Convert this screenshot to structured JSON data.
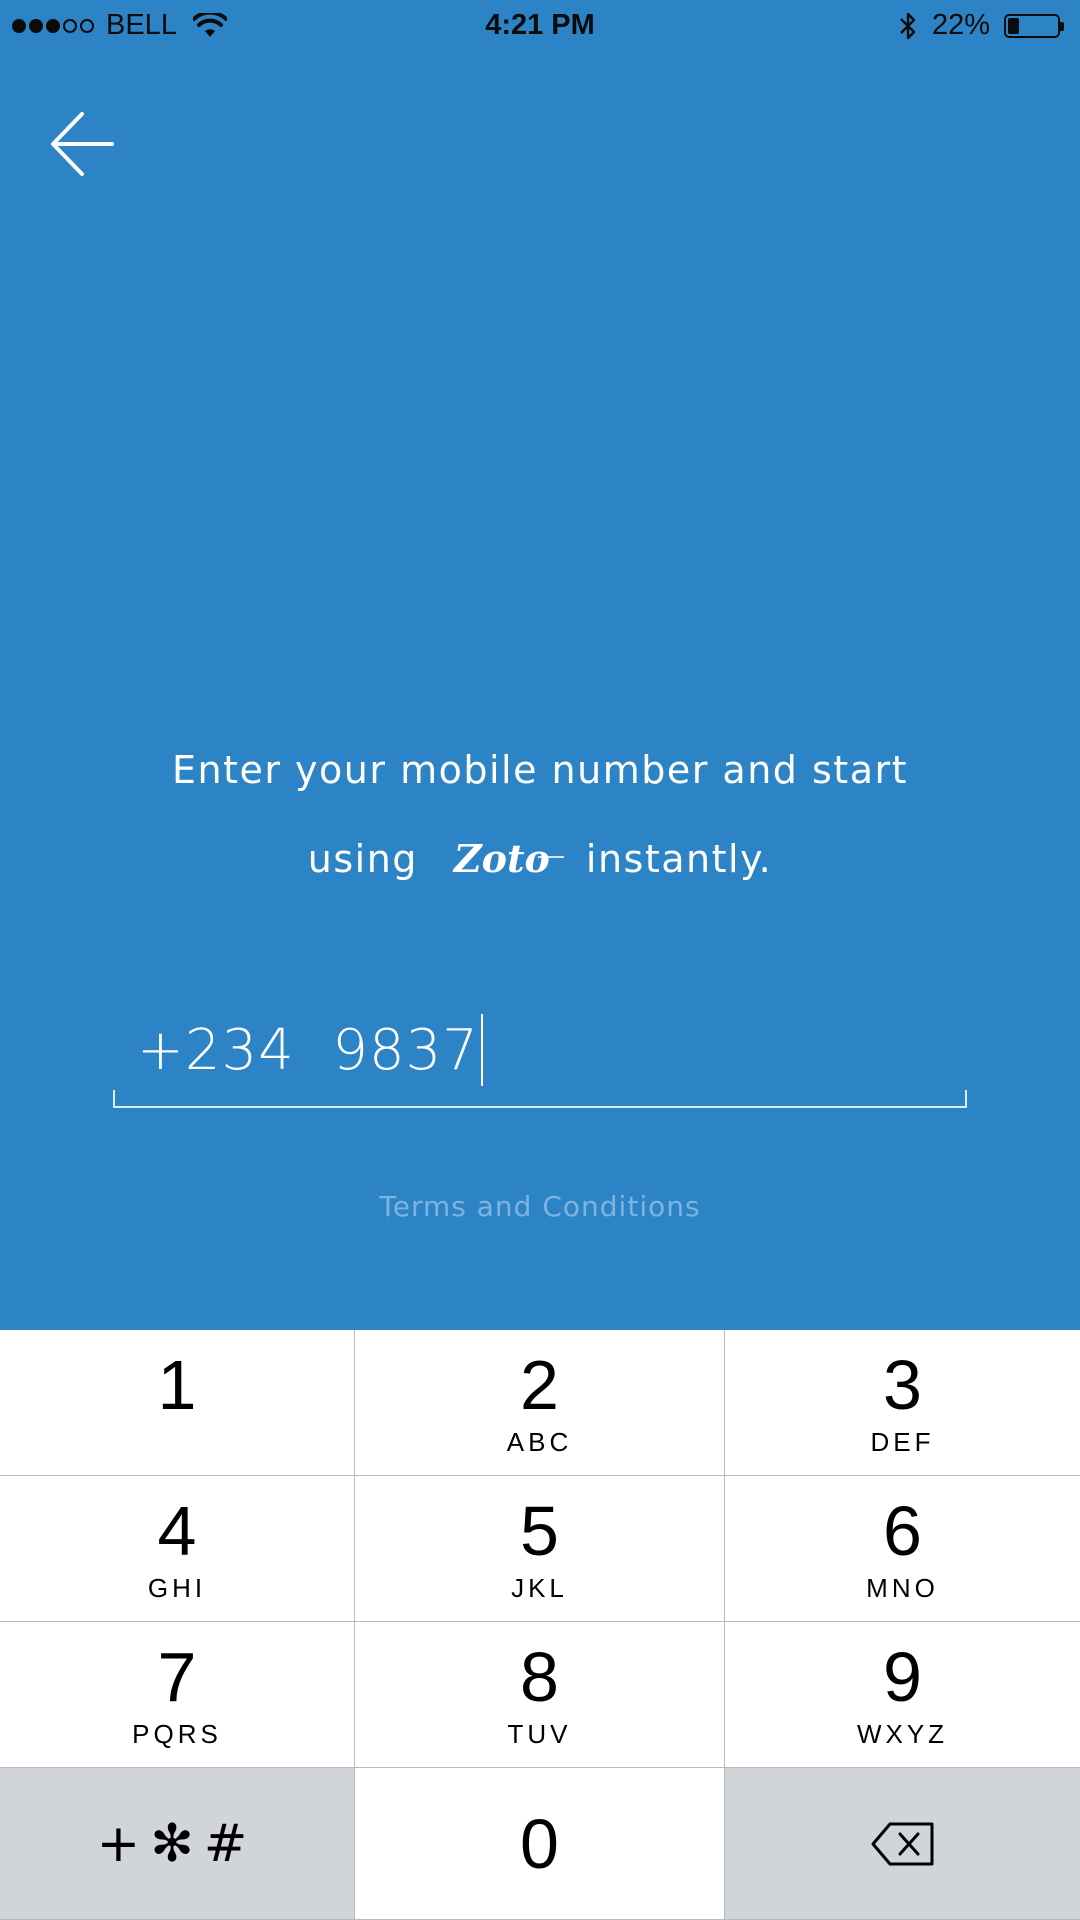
{
  "status_bar": {
    "signal_dots_filled": 3,
    "signal_dots_total": 5,
    "carrier": "BELL",
    "time": "4:21 PM",
    "battery_percent": "22%",
    "battery_level": 0.22,
    "icons": [
      "wifi-icon",
      "bluetooth-icon",
      "battery-icon"
    ]
  },
  "header": {
    "back_icon": "arrow-left-icon"
  },
  "prompt": {
    "line1": "Enter your mobile number and start",
    "line2_before": "using",
    "brand": "Zoto",
    "line2_after": "instantly."
  },
  "phone": {
    "value": "+234  9837"
  },
  "terms": {
    "label": "Terms and Conditions"
  },
  "keypad": {
    "keys": [
      {
        "digit": "1",
        "letters": ""
      },
      {
        "digit": "2",
        "letters": "ABC"
      },
      {
        "digit": "3",
        "letters": "DEF"
      },
      {
        "digit": "4",
        "letters": "GHI"
      },
      {
        "digit": "5",
        "letters": "JKL"
      },
      {
        "digit": "6",
        "letters": "MNO"
      },
      {
        "digit": "7",
        "letters": "PQRS"
      },
      {
        "digit": "8",
        "letters": "TUV"
      },
      {
        "digit": "9",
        "letters": "WXYZ"
      }
    ],
    "symbols": "+✻#",
    "zero": "0",
    "delete_icon": "backspace-icon"
  },
  "colors": {
    "background": "#2C84C6",
    "terms_link": "#7FB3DF",
    "keypad_key": "#FFFFFF",
    "keypad_function_key": "#D1D4D9"
  }
}
